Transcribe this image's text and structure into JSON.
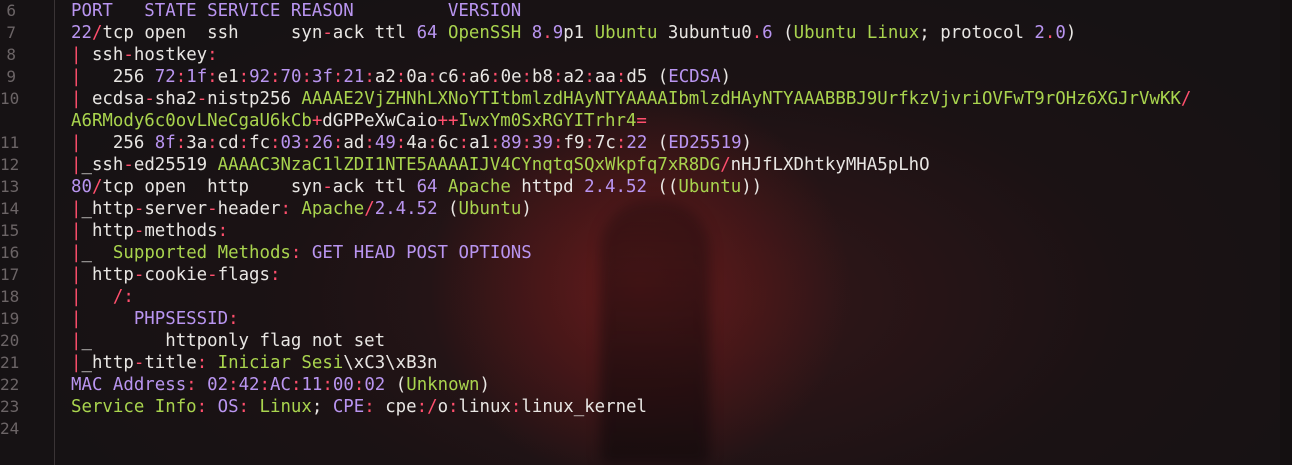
{
  "line_numbers": [
    "6",
    "7",
    "8",
    "9",
    "10",
    "",
    "11",
    "12",
    "13",
    "14",
    "15",
    "16",
    "17",
    "18",
    "19",
    "20",
    "21",
    "22",
    "23",
    "24"
  ],
  "lines": [
    [
      {
        "t": "PORT   STATE SERVICE REASON         VERSION",
        "c": "p"
      }
    ],
    [
      {
        "t": "22",
        "c": "p"
      },
      {
        "t": "/",
        "c": "r"
      },
      {
        "t": "tcp open  ssh     syn",
        "c": "w"
      },
      {
        "t": "-",
        "c": "r"
      },
      {
        "t": "ack ttl ",
        "c": "w"
      },
      {
        "t": "64",
        "c": "p"
      },
      {
        "t": " OpenSSH ",
        "c": "g"
      },
      {
        "t": "8",
        "c": "p"
      },
      {
        "t": ".",
        "c": "r"
      },
      {
        "t": "9",
        "c": "p"
      },
      {
        "t": "p1 ",
        "c": "w"
      },
      {
        "t": "Ubuntu",
        "c": "g"
      },
      {
        "t": " 3ubuntu0",
        "c": "w"
      },
      {
        "t": ".",
        "c": "r"
      },
      {
        "t": "6",
        "c": "p"
      },
      {
        "t": " (",
        "c": "w"
      },
      {
        "t": "Ubuntu Linux",
        "c": "g"
      },
      {
        "t": "; protocol ",
        "c": "w"
      },
      {
        "t": "2",
        "c": "p"
      },
      {
        "t": ".",
        "c": "r"
      },
      {
        "t": "0",
        "c": "p"
      },
      {
        "t": ")",
        "c": "w"
      }
    ],
    [
      {
        "t": "|",
        "c": "r"
      },
      {
        "t": " ssh",
        "c": "w"
      },
      {
        "t": "-",
        "c": "r"
      },
      {
        "t": "hostkey",
        "c": "w"
      },
      {
        "t": ":",
        "c": "r"
      }
    ],
    [
      {
        "t": "|",
        "c": "r"
      },
      {
        "t": "   256 ",
        "c": "w"
      },
      {
        "t": "72",
        "c": "p"
      },
      {
        "t": ":",
        "c": "r"
      },
      {
        "t": "1f",
        "c": "p"
      },
      {
        "t": ":",
        "c": "r"
      },
      {
        "t": "e1",
        "c": "w"
      },
      {
        "t": ":",
        "c": "r"
      },
      {
        "t": "92",
        "c": "p"
      },
      {
        "t": ":",
        "c": "r"
      },
      {
        "t": "70",
        "c": "p"
      },
      {
        "t": ":",
        "c": "r"
      },
      {
        "t": "3f",
        "c": "p"
      },
      {
        "t": ":",
        "c": "r"
      },
      {
        "t": "21",
        "c": "p"
      },
      {
        "t": ":",
        "c": "r"
      },
      {
        "t": "a2",
        "c": "w"
      },
      {
        "t": ":",
        "c": "r"
      },
      {
        "t": "0a",
        "c": "w"
      },
      {
        "t": ":",
        "c": "r"
      },
      {
        "t": "c6",
        "c": "w"
      },
      {
        "t": ":",
        "c": "r"
      },
      {
        "t": "a6",
        "c": "w"
      },
      {
        "t": ":",
        "c": "r"
      },
      {
        "t": "0e",
        "c": "w"
      },
      {
        "t": ":",
        "c": "r"
      },
      {
        "t": "b8",
        "c": "w"
      },
      {
        "t": ":",
        "c": "r"
      },
      {
        "t": "a2",
        "c": "w"
      },
      {
        "t": ":",
        "c": "r"
      },
      {
        "t": "aa",
        "c": "w"
      },
      {
        "t": ":",
        "c": "r"
      },
      {
        "t": "d5 (",
        "c": "w"
      },
      {
        "t": "ECDSA",
        "c": "p"
      },
      {
        "t": ")",
        "c": "w"
      }
    ],
    [
      {
        "t": "|",
        "c": "r"
      },
      {
        "t": " ecdsa",
        "c": "w"
      },
      {
        "t": "-",
        "c": "r"
      },
      {
        "t": "sha2",
        "c": "w"
      },
      {
        "t": "-",
        "c": "r"
      },
      {
        "t": "nistp256 ",
        "c": "w"
      },
      {
        "t": "AAAAE2VjZHNhLXNoYTItbmlzdHAyNTYAAAAIbmlzdHAyNTYAAABBBJ9UrfkzVjvriOVFwT9rOHz6XGJrVwKK",
        "c": "g"
      },
      {
        "t": "/",
        "c": "r"
      }
    ],
    [
      {
        "t": "A6RMody6c0ovLNeCgaU6kCb",
        "c": "g"
      },
      {
        "t": "+",
        "c": "r"
      },
      {
        "t": "dGPPeXwCaio",
        "c": "w"
      },
      {
        "t": "++",
        "c": "r"
      },
      {
        "t": "IwxYm0SxRGYITrhr4",
        "c": "g"
      },
      {
        "t": "=",
        "c": "r"
      }
    ],
    [
      {
        "t": "|",
        "c": "r"
      },
      {
        "t": "   256 ",
        "c": "w"
      },
      {
        "t": "8f",
        "c": "p"
      },
      {
        "t": ":",
        "c": "r"
      },
      {
        "t": "3a",
        "c": "w"
      },
      {
        "t": ":",
        "c": "r"
      },
      {
        "t": "cd",
        "c": "w"
      },
      {
        "t": ":",
        "c": "r"
      },
      {
        "t": "fc",
        "c": "w"
      },
      {
        "t": ":",
        "c": "r"
      },
      {
        "t": "03",
        "c": "p"
      },
      {
        "t": ":",
        "c": "r"
      },
      {
        "t": "26",
        "c": "p"
      },
      {
        "t": ":",
        "c": "r"
      },
      {
        "t": "ad",
        "c": "w"
      },
      {
        "t": ":",
        "c": "r"
      },
      {
        "t": "49",
        "c": "p"
      },
      {
        "t": ":",
        "c": "r"
      },
      {
        "t": "4a",
        "c": "w"
      },
      {
        "t": ":",
        "c": "r"
      },
      {
        "t": "6c",
        "c": "w"
      },
      {
        "t": ":",
        "c": "r"
      },
      {
        "t": "a1",
        "c": "w"
      },
      {
        "t": ":",
        "c": "r"
      },
      {
        "t": "89",
        "c": "p"
      },
      {
        "t": ":",
        "c": "r"
      },
      {
        "t": "39",
        "c": "p"
      },
      {
        "t": ":",
        "c": "r"
      },
      {
        "t": "f9",
        "c": "w"
      },
      {
        "t": ":",
        "c": "r"
      },
      {
        "t": "7c",
        "c": "w"
      },
      {
        "t": ":",
        "c": "r"
      },
      {
        "t": "22",
        "c": "p"
      },
      {
        "t": " (",
        "c": "w"
      },
      {
        "t": "ED25519",
        "c": "p"
      },
      {
        "t": ")",
        "c": "w"
      }
    ],
    [
      {
        "t": "|",
        "c": "r"
      },
      {
        "t": "_ssh",
        "c": "w"
      },
      {
        "t": "-",
        "c": "r"
      },
      {
        "t": "ed25519 ",
        "c": "w"
      },
      {
        "t": "AAAAC3NzaC1lZDI1NTE5AAAAIJV4CYnqtqSQxWkpfq7xR8DG",
        "c": "g"
      },
      {
        "t": "/",
        "c": "r"
      },
      {
        "t": "nHJfLXDhtkyMHA5pLhO",
        "c": "w"
      }
    ],
    [
      {
        "t": "80",
        "c": "p"
      },
      {
        "t": "/",
        "c": "r"
      },
      {
        "t": "tcp open  http    syn",
        "c": "w"
      },
      {
        "t": "-",
        "c": "r"
      },
      {
        "t": "ack ttl ",
        "c": "w"
      },
      {
        "t": "64",
        "c": "p"
      },
      {
        "t": " Apache ",
        "c": "g"
      },
      {
        "t": "httpd ",
        "c": "w"
      },
      {
        "t": "2.4.52",
        "c": "p"
      },
      {
        "t": " ((",
        "c": "w"
      },
      {
        "t": "Ubuntu",
        "c": "g"
      },
      {
        "t": "))",
        "c": "w"
      }
    ],
    [
      {
        "t": "|",
        "c": "r"
      },
      {
        "t": "_http",
        "c": "w"
      },
      {
        "t": "-",
        "c": "r"
      },
      {
        "t": "server",
        "c": "w"
      },
      {
        "t": "-",
        "c": "r"
      },
      {
        "t": "header",
        "c": "w"
      },
      {
        "t": ": ",
        "c": "r"
      },
      {
        "t": "Apache",
        "c": "g"
      },
      {
        "t": "/",
        "c": "r"
      },
      {
        "t": "2.4.52",
        "c": "p"
      },
      {
        "t": " (",
        "c": "w"
      },
      {
        "t": "Ubuntu",
        "c": "g"
      },
      {
        "t": ")",
        "c": "w"
      }
    ],
    [
      {
        "t": "|",
        "c": "r"
      },
      {
        "t": " http",
        "c": "w"
      },
      {
        "t": "-",
        "c": "r"
      },
      {
        "t": "methods",
        "c": "w"
      },
      {
        "t": ":",
        "c": "r"
      }
    ],
    [
      {
        "t": "|",
        "c": "r"
      },
      {
        "t": "_  ",
        "c": "w"
      },
      {
        "t": "Supported Methods",
        "c": "g"
      },
      {
        "t": ": ",
        "c": "r"
      },
      {
        "t": "GET HEAD POST OPTIONS",
        "c": "p"
      }
    ],
    [
      {
        "t": "|",
        "c": "r"
      },
      {
        "t": " http",
        "c": "w"
      },
      {
        "t": "-",
        "c": "r"
      },
      {
        "t": "cookie",
        "c": "w"
      },
      {
        "t": "-",
        "c": "r"
      },
      {
        "t": "flags",
        "c": "w"
      },
      {
        "t": ":",
        "c": "r"
      }
    ],
    [
      {
        "t": "|",
        "c": "r"
      },
      {
        "t": "   /:",
        "c": "r"
      }
    ],
    [
      {
        "t": "|",
        "c": "r"
      },
      {
        "t": "     PHPSESSID",
        "c": "p"
      },
      {
        "t": ":",
        "c": "r"
      }
    ],
    [
      {
        "t": "|",
        "c": "r"
      },
      {
        "t": "_       httponly flag not set",
        "c": "w"
      }
    ],
    [
      {
        "t": "|",
        "c": "r"
      },
      {
        "t": "_http",
        "c": "w"
      },
      {
        "t": "-",
        "c": "r"
      },
      {
        "t": "title",
        "c": "w"
      },
      {
        "t": ": ",
        "c": "r"
      },
      {
        "t": "Iniciar Sesi",
        "c": "g"
      },
      {
        "t": "\\xC3\\xB3n",
        "c": "w"
      }
    ],
    [
      {
        "t": "MAC Address",
        "c": "p"
      },
      {
        "t": ": ",
        "c": "r"
      },
      {
        "t": "02",
        "c": "p"
      },
      {
        "t": ":",
        "c": "r"
      },
      {
        "t": "42",
        "c": "p"
      },
      {
        "t": ":",
        "c": "r"
      },
      {
        "t": "AC",
        "c": "p"
      },
      {
        "t": ":",
        "c": "r"
      },
      {
        "t": "11",
        "c": "p"
      },
      {
        "t": ":",
        "c": "r"
      },
      {
        "t": "00",
        "c": "p"
      },
      {
        "t": ":",
        "c": "r"
      },
      {
        "t": "02",
        "c": "p"
      },
      {
        "t": " (",
        "c": "w"
      },
      {
        "t": "Unknown",
        "c": "g"
      },
      {
        "t": ")",
        "c": "w"
      }
    ],
    [
      {
        "t": "Service Info",
        "c": "g"
      },
      {
        "t": ": ",
        "c": "r"
      },
      {
        "t": "OS",
        "c": "p"
      },
      {
        "t": ": ",
        "c": "r"
      },
      {
        "t": "Linux",
        "c": "g"
      },
      {
        "t": "; ",
        "c": "w"
      },
      {
        "t": "CPE",
        "c": "p"
      },
      {
        "t": ": ",
        "c": "r"
      },
      {
        "t": "cpe",
        "c": "w"
      },
      {
        "t": ":/",
        "c": "r"
      },
      {
        "t": "o",
        "c": "w"
      },
      {
        "t": ":",
        "c": "r"
      },
      {
        "t": "linux",
        "c": "w"
      },
      {
        "t": ":",
        "c": "r"
      },
      {
        "t": "linux_kernel",
        "c": "w"
      }
    ],
    []
  ],
  "colors": {
    "purple": "#b995f0",
    "green": "#a9d44e",
    "white": "#e8e6e3",
    "red": "#ff4f6d",
    "gutter": "#6b6466",
    "background": "#161214"
  }
}
